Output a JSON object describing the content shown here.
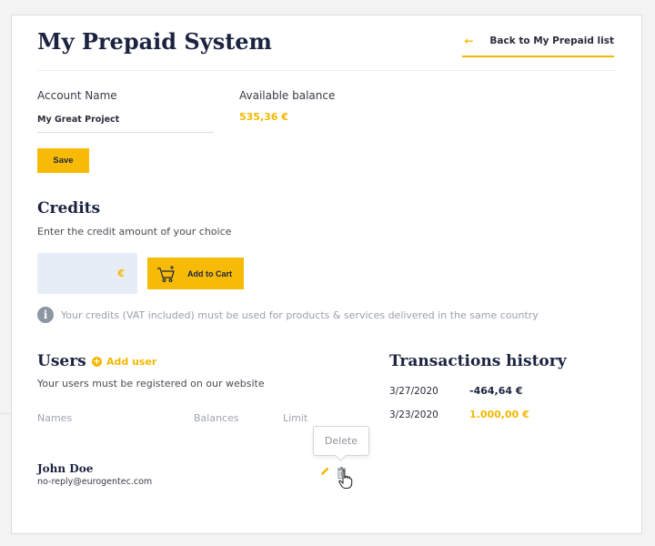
{
  "header": {
    "title": "My Prepaid System",
    "back_arrow": "←",
    "back_label": "Back to My Prepaid list"
  },
  "account": {
    "name_label": "Account Name",
    "name_value": "My Great Project",
    "balance_label": "Available balance",
    "balance_value": "535,36 €",
    "save_label": "Save"
  },
  "credits": {
    "title": "Credits",
    "description": "Enter the credit amount of your choice",
    "currency_symbol": "€",
    "add_to_cart_label": "Add to Cart",
    "info_text": "Your credits (VAT included) must be used for products & services delivered in the same country"
  },
  "users": {
    "title": "Users",
    "add_user_label": "Add user",
    "description": "Your users must be registered on our website",
    "columns": [
      "Names",
      "Balances",
      "Limit"
    ],
    "rows": [
      {
        "name": "John Doe",
        "email": "no-reply@eurogentec.com"
      }
    ],
    "tooltip": "Delete"
  },
  "transactions": {
    "title": "Transactions history",
    "rows": [
      {
        "date": "3/27/2020",
        "amount": "-464,64 €",
        "color": "#1c2340"
      },
      {
        "date": "3/23/2020",
        "amount": "1.000,00 €",
        "color": "#f5b800"
      }
    ]
  },
  "colors": {
    "accent": "#f7bb07",
    "navy": "#1c2340",
    "input_bg": "#e7edf7"
  }
}
